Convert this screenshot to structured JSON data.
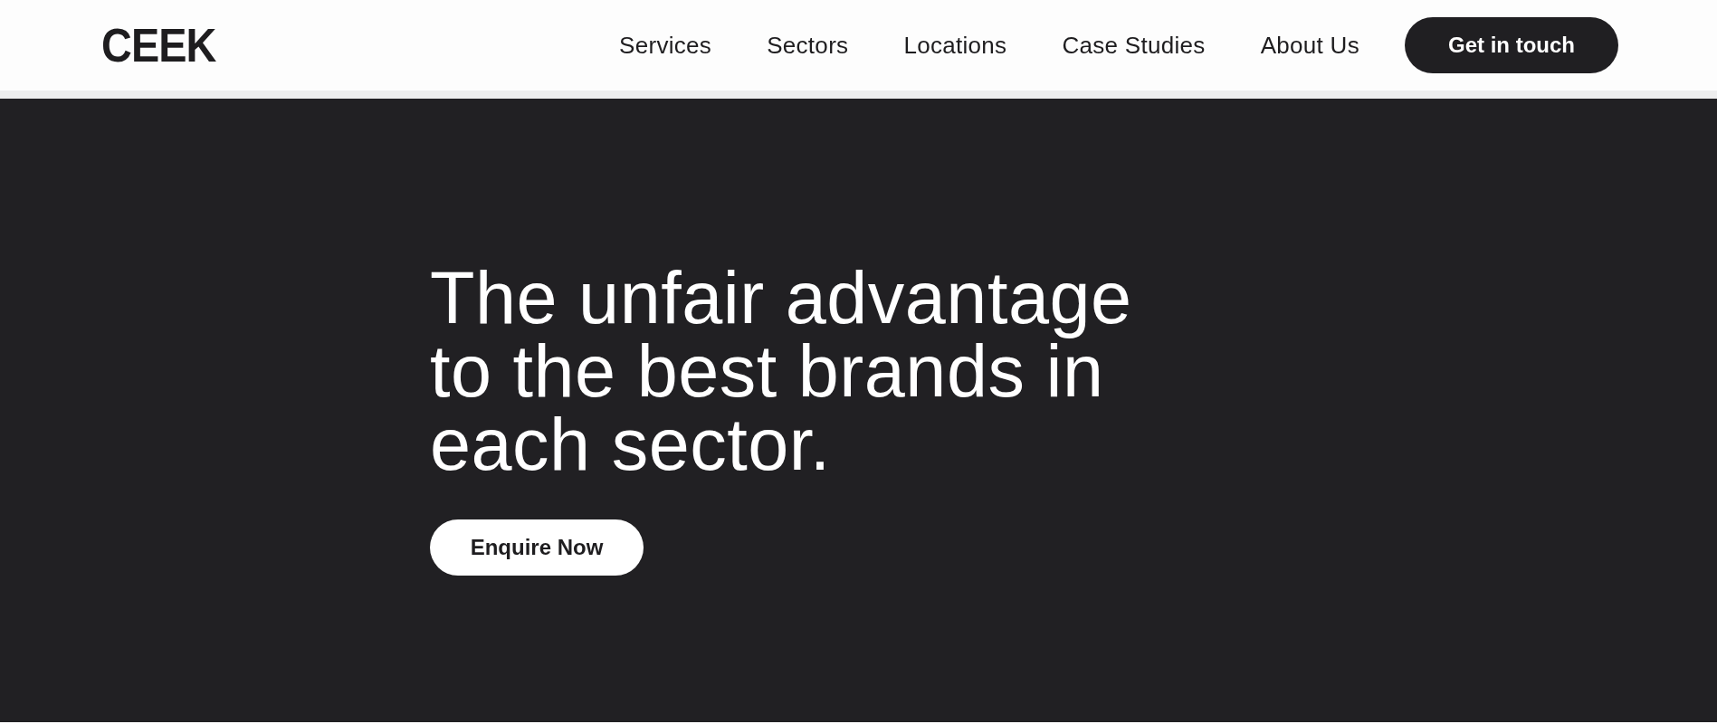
{
  "header": {
    "logo": "CEEK",
    "nav": [
      {
        "label": "Services"
      },
      {
        "label": "Sectors"
      },
      {
        "label": "Locations"
      },
      {
        "label": "Case Studies"
      },
      {
        "label": "About Us"
      }
    ],
    "cta": "Get in touch"
  },
  "hero": {
    "headline": "The unfair advantage to the best brands in each sector.",
    "button": "Enquire Now"
  }
}
